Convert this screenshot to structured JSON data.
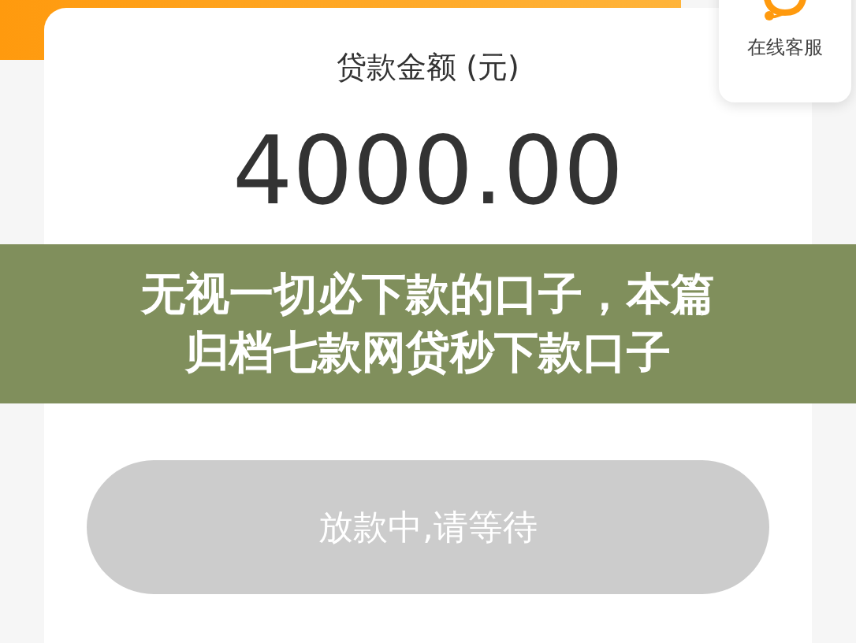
{
  "support": {
    "label": "在线客服"
  },
  "loan": {
    "label": "贷款金额 (元)",
    "amount": "4000.00"
  },
  "caption": {
    "lines": [
      "无视一切必下款的口子，本篇",
      "归档七款网贷秒下款口子"
    ]
  },
  "action_button": {
    "label": "放款中,请等待",
    "disabled": true
  }
}
